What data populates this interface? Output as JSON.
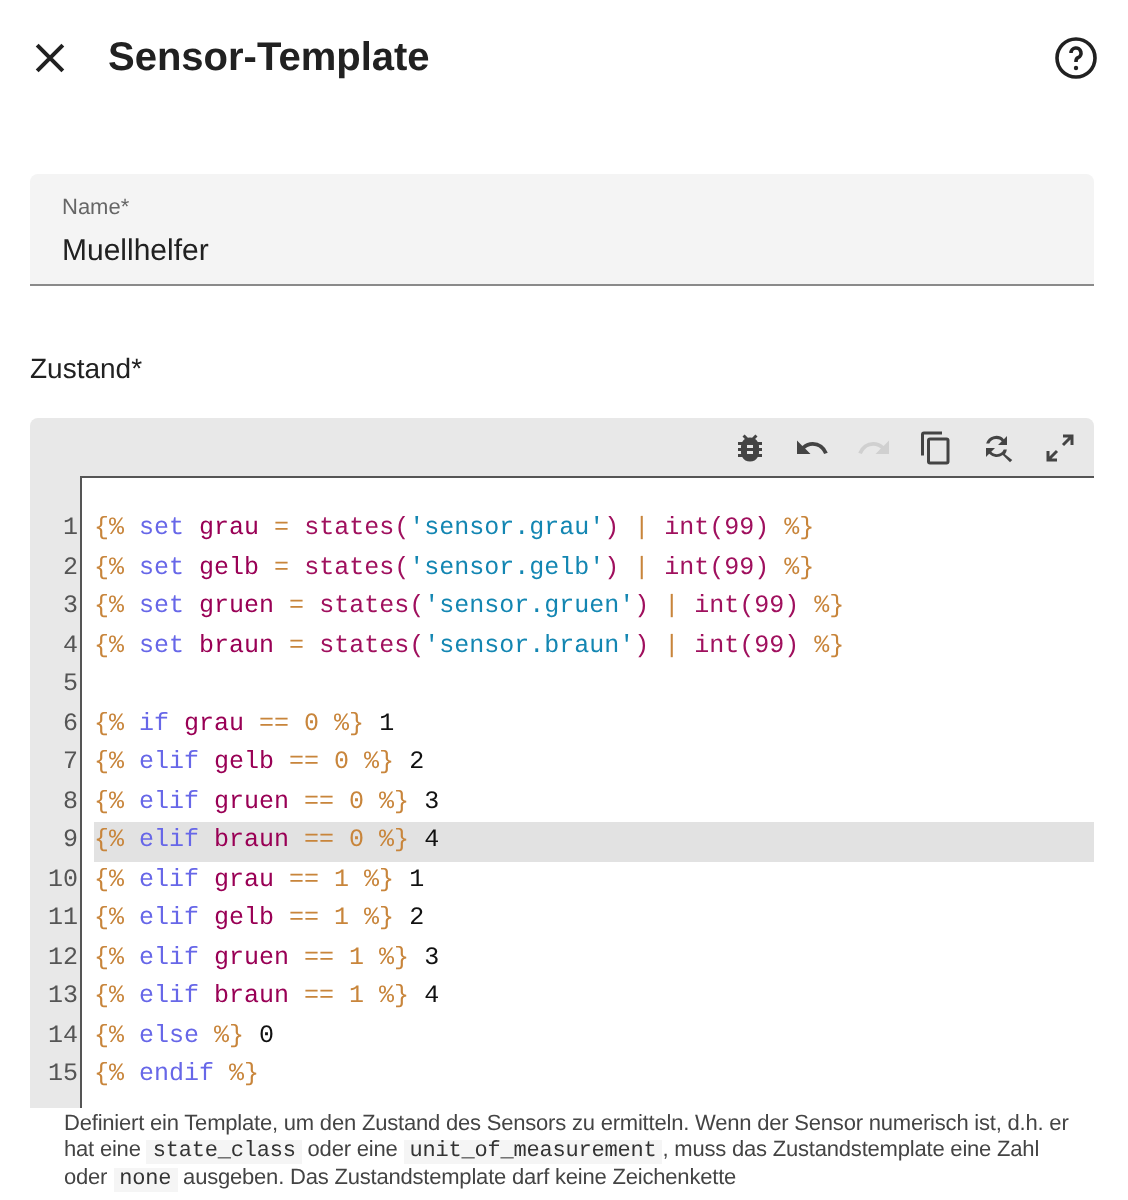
{
  "header": {
    "title": "Sensor-Template"
  },
  "name_field": {
    "label": "Name*",
    "value": "Muellhelfer"
  },
  "state_label": "Zustand*",
  "toolbar": [
    {
      "kind": "bug",
      "disabled": false
    },
    {
      "kind": "undo",
      "disabled": false
    },
    {
      "kind": "redo",
      "disabled": true
    },
    {
      "kind": "copy",
      "disabled": false
    },
    {
      "kind": "replace",
      "disabled": false
    },
    {
      "kind": "fullscreen",
      "disabled": false
    }
  ],
  "code_lines": [
    {
      "number": "1",
      "active": false,
      "tokens": [
        {
          "t": "{% ",
          "kind": "punct"
        },
        {
          "t": "set ",
          "kind": "keyword"
        },
        {
          "t": "grau ",
          "kind": "variable"
        },
        {
          "t": "= ",
          "kind": "punct"
        },
        {
          "t": "states(",
          "kind": "func"
        },
        {
          "t": "'sensor.grau'",
          "kind": "string"
        },
        {
          "t": ") ",
          "kind": "func"
        },
        {
          "t": "| ",
          "kind": "punct"
        },
        {
          "t": "int(99) ",
          "kind": "func"
        },
        {
          "t": "%}",
          "kind": "punct"
        }
      ]
    },
    {
      "number": "2",
      "active": false,
      "tokens": [
        {
          "t": "{% ",
          "kind": "punct"
        },
        {
          "t": "set ",
          "kind": "keyword"
        },
        {
          "t": "gelb ",
          "kind": "variable"
        },
        {
          "t": "= ",
          "kind": "punct"
        },
        {
          "t": "states(",
          "kind": "func"
        },
        {
          "t": "'sensor.gelb'",
          "kind": "string"
        },
        {
          "t": ") ",
          "kind": "func"
        },
        {
          "t": "| ",
          "kind": "punct"
        },
        {
          "t": "int(99) ",
          "kind": "func"
        },
        {
          "t": "%}",
          "kind": "punct"
        }
      ]
    },
    {
      "number": "3",
      "active": false,
      "tokens": [
        {
          "t": "{% ",
          "kind": "punct"
        },
        {
          "t": "set ",
          "kind": "keyword"
        },
        {
          "t": "gruen ",
          "kind": "variable"
        },
        {
          "t": "= ",
          "kind": "punct"
        },
        {
          "t": "states(",
          "kind": "func"
        },
        {
          "t": "'sensor.gruen'",
          "kind": "string"
        },
        {
          "t": ") ",
          "kind": "func"
        },
        {
          "t": "| ",
          "kind": "punct"
        },
        {
          "t": "int(99) ",
          "kind": "func"
        },
        {
          "t": "%}",
          "kind": "punct"
        }
      ]
    },
    {
      "number": "4",
      "active": false,
      "tokens": [
        {
          "t": "{% ",
          "kind": "punct"
        },
        {
          "t": "set ",
          "kind": "keyword"
        },
        {
          "t": "braun ",
          "kind": "variable"
        },
        {
          "t": "= ",
          "kind": "punct"
        },
        {
          "t": "states(",
          "kind": "func"
        },
        {
          "t": "'sensor.braun'",
          "kind": "string"
        },
        {
          "t": ") ",
          "kind": "func"
        },
        {
          "t": "| ",
          "kind": "punct"
        },
        {
          "t": "int(99) ",
          "kind": "func"
        },
        {
          "t": "%}",
          "kind": "punct"
        }
      ]
    },
    {
      "number": "5",
      "active": false
    },
    {
      "number": "6",
      "active": false,
      "tokens": [
        {
          "t": "{% ",
          "kind": "punct"
        },
        {
          "t": "if ",
          "kind": "keyword"
        },
        {
          "t": "grau ",
          "kind": "variable"
        },
        {
          "t": "== 0 %}",
          "kind": "punct"
        },
        {
          "t": " 1",
          "kind": "output"
        }
      ]
    },
    {
      "number": "7",
      "active": false,
      "tokens": [
        {
          "t": "{% ",
          "kind": "punct"
        },
        {
          "t": "elif ",
          "kind": "keyword"
        },
        {
          "t": "gelb ",
          "kind": "variable"
        },
        {
          "t": "== 0 %}",
          "kind": "punct"
        },
        {
          "t": " 2",
          "kind": "output"
        }
      ]
    },
    {
      "number": "8",
      "active": false,
      "tokens": [
        {
          "t": "{% ",
          "kind": "punct"
        },
        {
          "t": "elif ",
          "kind": "keyword"
        },
        {
          "t": "gruen ",
          "kind": "variable"
        },
        {
          "t": "== 0 %}",
          "kind": "punct"
        },
        {
          "t": " 3",
          "kind": "output"
        }
      ]
    },
    {
      "number": "9",
      "active": true,
      "tokens": [
        {
          "t": "{% ",
          "kind": "punct"
        },
        {
          "t": "elif ",
          "kind": "keyword"
        },
        {
          "t": "braun ",
          "kind": "variable"
        },
        {
          "t": "== 0 %}",
          "kind": "punct"
        },
        {
          "t": " 4",
          "kind": "output"
        }
      ]
    },
    {
      "number": "10",
      "active": false,
      "tokens": [
        {
          "t": "{% ",
          "kind": "punct"
        },
        {
          "t": "elif ",
          "kind": "keyword"
        },
        {
          "t": "grau ",
          "kind": "variable"
        },
        {
          "t": "== 1 %}",
          "kind": "punct"
        },
        {
          "t": " 1",
          "kind": "output"
        }
      ]
    },
    {
      "number": "11",
      "active": false,
      "tokens": [
        {
          "t": "{% ",
          "kind": "punct"
        },
        {
          "t": "elif ",
          "kind": "keyword"
        },
        {
          "t": "gelb ",
          "kind": "variable"
        },
        {
          "t": "== 1 %}",
          "kind": "punct"
        },
        {
          "t": " 2",
          "kind": "output"
        }
      ]
    },
    {
      "number": "12",
      "active": false,
      "tokens": [
        {
          "t": "{% ",
          "kind": "punct"
        },
        {
          "t": "elif ",
          "kind": "keyword"
        },
        {
          "t": "gruen ",
          "kind": "variable"
        },
        {
          "t": "== 1 %}",
          "kind": "punct"
        },
        {
          "t": " 3",
          "kind": "output"
        }
      ]
    },
    {
      "number": "13",
      "active": false,
      "tokens": [
        {
          "t": "{% ",
          "kind": "punct"
        },
        {
          "t": "elif ",
          "kind": "keyword"
        },
        {
          "t": "braun ",
          "kind": "variable"
        },
        {
          "t": "== 1 %}",
          "kind": "punct"
        },
        {
          "t": " 4",
          "kind": "output"
        }
      ]
    },
    {
      "number": "14",
      "active": false,
      "tokens": [
        {
          "t": "{% ",
          "kind": "punct"
        },
        {
          "t": "else ",
          "kind": "keyword"
        },
        {
          "t": "%}",
          "kind": "punct"
        },
        {
          "t": " 0",
          "kind": "output"
        }
      ]
    },
    {
      "number": "15",
      "active": false,
      "tokens": [
        {
          "t": "{% ",
          "kind": "punct"
        },
        {
          "t": "endif ",
          "kind": "keyword"
        },
        {
          "t": "%}",
          "kind": "punct"
        }
      ]
    }
  ],
  "helper_text": [
    {
      "kind": "text",
      "t": "Definiert ein Template, um den Zustand des Sensors zu ermitteln. Wenn der Sensor numerisch ist, d.h. er hat eine "
    },
    {
      "kind": "code",
      "t": "state_class"
    },
    {
      "kind": "text",
      "t": " oder eine "
    },
    {
      "kind": "code",
      "t": "unit_of_measurement"
    },
    {
      "kind": "text",
      "t": ", muss das Zustandstemplate eine Zahl oder "
    },
    {
      "kind": "code",
      "t": "none"
    },
    {
      "kind": "text",
      "t": " ausgeben. Das Zustandstemplate darf keine Zeichenkette"
    }
  ]
}
